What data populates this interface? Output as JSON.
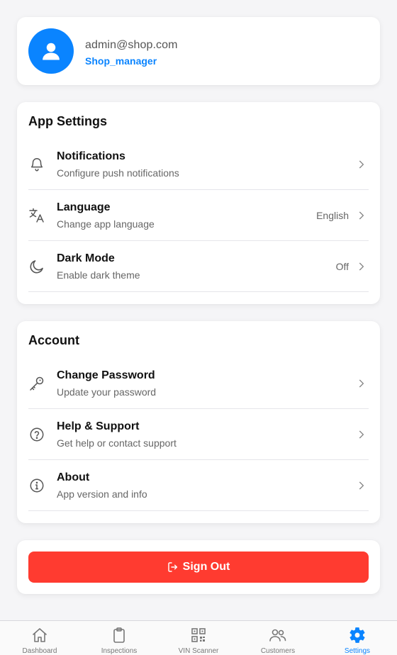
{
  "profile": {
    "email": "admin@shop.com",
    "role": "Shop_manager",
    "avatar_icon": "user-icon"
  },
  "app_settings": {
    "title": "App Settings",
    "items": [
      {
        "label": "Notifications",
        "sub": "Configure push notifications",
        "value": "",
        "icon": "bell-icon"
      },
      {
        "label": "Language",
        "sub": "Change app language",
        "value": "English",
        "icon": "translate-icon"
      },
      {
        "label": "Dark Mode",
        "sub": "Enable dark theme",
        "value": "Off",
        "icon": "moon-icon"
      }
    ]
  },
  "account": {
    "title": "Account",
    "items": [
      {
        "label": "Change Password",
        "sub": "Update your password",
        "icon": "key-icon"
      },
      {
        "label": "Help & Support",
        "sub": "Get help or contact support",
        "icon": "help-circle-icon"
      },
      {
        "label": "About",
        "sub": "App version and info",
        "icon": "info-circle-icon"
      }
    ]
  },
  "sign_out": {
    "label": "Sign Out",
    "icon": "logout-icon"
  },
  "tabs": [
    {
      "label": "Dashboard",
      "icon": "home-icon",
      "active": false
    },
    {
      "label": "Inspections",
      "icon": "clipboard-icon",
      "active": false
    },
    {
      "label": "VIN Scanner",
      "icon": "qr-code-icon",
      "active": false
    },
    {
      "label": "Customers",
      "icon": "users-icon",
      "active": false
    },
    {
      "label": "Settings",
      "icon": "gear-icon",
      "active": true
    }
  ],
  "colors": {
    "accent": "#0a84ff",
    "danger": "#ff3b30",
    "background": "#f5f5f7",
    "text_primary": "#111111",
    "text_secondary": "#666666"
  }
}
